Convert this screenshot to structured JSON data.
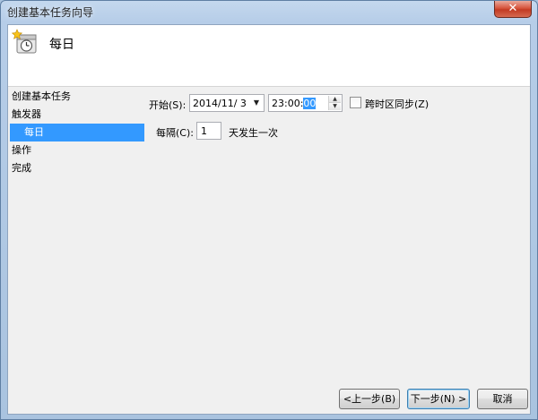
{
  "window": {
    "title": "创建基本任务向导",
    "close_label": "✕"
  },
  "header": {
    "title": "每日",
    "icon": "clock-star-icon"
  },
  "nav": {
    "items": [
      {
        "label": "创建基本任务"
      },
      {
        "label": "触发器"
      },
      {
        "label": "每日"
      },
      {
        "label": "操作"
      },
      {
        "label": "完成"
      }
    ],
    "selected": "每日"
  },
  "form": {
    "start_label": "开始(S):",
    "start_date": "2014/11/  3",
    "start_time_prefix": "23:00:",
    "start_time_selected": "00",
    "sync_timezones_label": "跨时区同步(Z)",
    "sync_timezones_checked": false,
    "interval_label": "每隔(C):",
    "interval_value": "1",
    "interval_suffix": "天发生一次"
  },
  "buttons": {
    "back": "<上一步(B)",
    "next": "下一步(N) >",
    "cancel": "取消"
  },
  "colors": {
    "selection": "#3399ff",
    "titlebar": "#b6cde8",
    "close_button": "#c23a22"
  }
}
